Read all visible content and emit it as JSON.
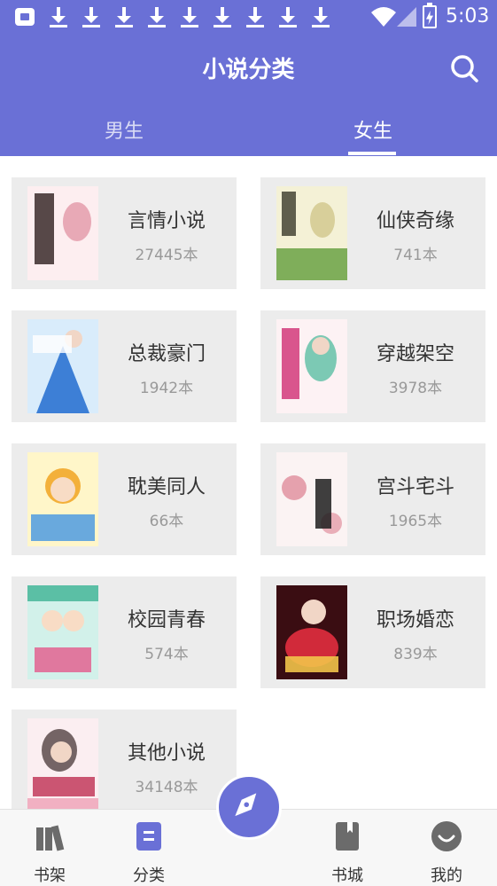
{
  "status_bar": {
    "time": "5:03",
    "icons": [
      "app-notification-icon",
      "download-icon",
      "wifi-icon",
      "signal-icon",
      "battery-charging-icon"
    ]
  },
  "header": {
    "title": "小说分类",
    "search_icon": "search-icon",
    "background_color": "#6a70d6"
  },
  "tabs": [
    {
      "label": "男生",
      "active": false
    },
    {
      "label": "女生",
      "active": true
    }
  ],
  "categories": [
    {
      "title": "言情小说",
      "count": "27445本",
      "cover_colors": [
        "#fdeef0",
        "#e8a9b6",
        "#3a2a2a"
      ]
    },
    {
      "title": "仙侠奇缘",
      "count": "741本",
      "cover_colors": [
        "#f4f1d6",
        "#7fae5a",
        "#3a3a2a"
      ]
    },
    {
      "title": "总裁豪门",
      "count": "1942本",
      "cover_colors": [
        "#d9ecfb",
        "#3d7fd6",
        "#ffffff"
      ]
    },
    {
      "title": "穿越架空",
      "count": "3978本",
      "cover_colors": [
        "#fdf2f4",
        "#d23a7a",
        "#7cc9b4"
      ]
    },
    {
      "title": "耽美同人",
      "count": "66本",
      "cover_colors": [
        "#fff6c9",
        "#f3b03a",
        "#4f9be0"
      ]
    },
    {
      "title": "宫斗宅斗",
      "count": "1965本",
      "cover_colors": [
        "#fbf3f3",
        "#d76a7e",
        "#1d1d1d"
      ]
    },
    {
      "title": "校园青春",
      "count": "574本",
      "cover_colors": [
        "#d2f1ea",
        "#5bbfa5",
        "#e45a8b"
      ]
    },
    {
      "title": "职场婚恋",
      "count": "839本",
      "cover_colors": [
        "#3a0d12",
        "#d12a3a",
        "#f2c34a"
      ]
    },
    {
      "title": "其他小说",
      "count": "34148本",
      "cover_colors": [
        "#fbeef1",
        "#f1b0c2",
        "#c23a5c"
      ]
    }
  ],
  "bottom_nav": [
    {
      "label": "书架",
      "icon": "bookshelf-icon"
    },
    {
      "label": "分类",
      "icon": "category-icon",
      "active": true
    },
    {
      "label": "",
      "icon": "compass-icon"
    },
    {
      "label": "书城",
      "icon": "bookstore-icon"
    },
    {
      "label": "我的",
      "icon": "profile-icon"
    }
  ]
}
